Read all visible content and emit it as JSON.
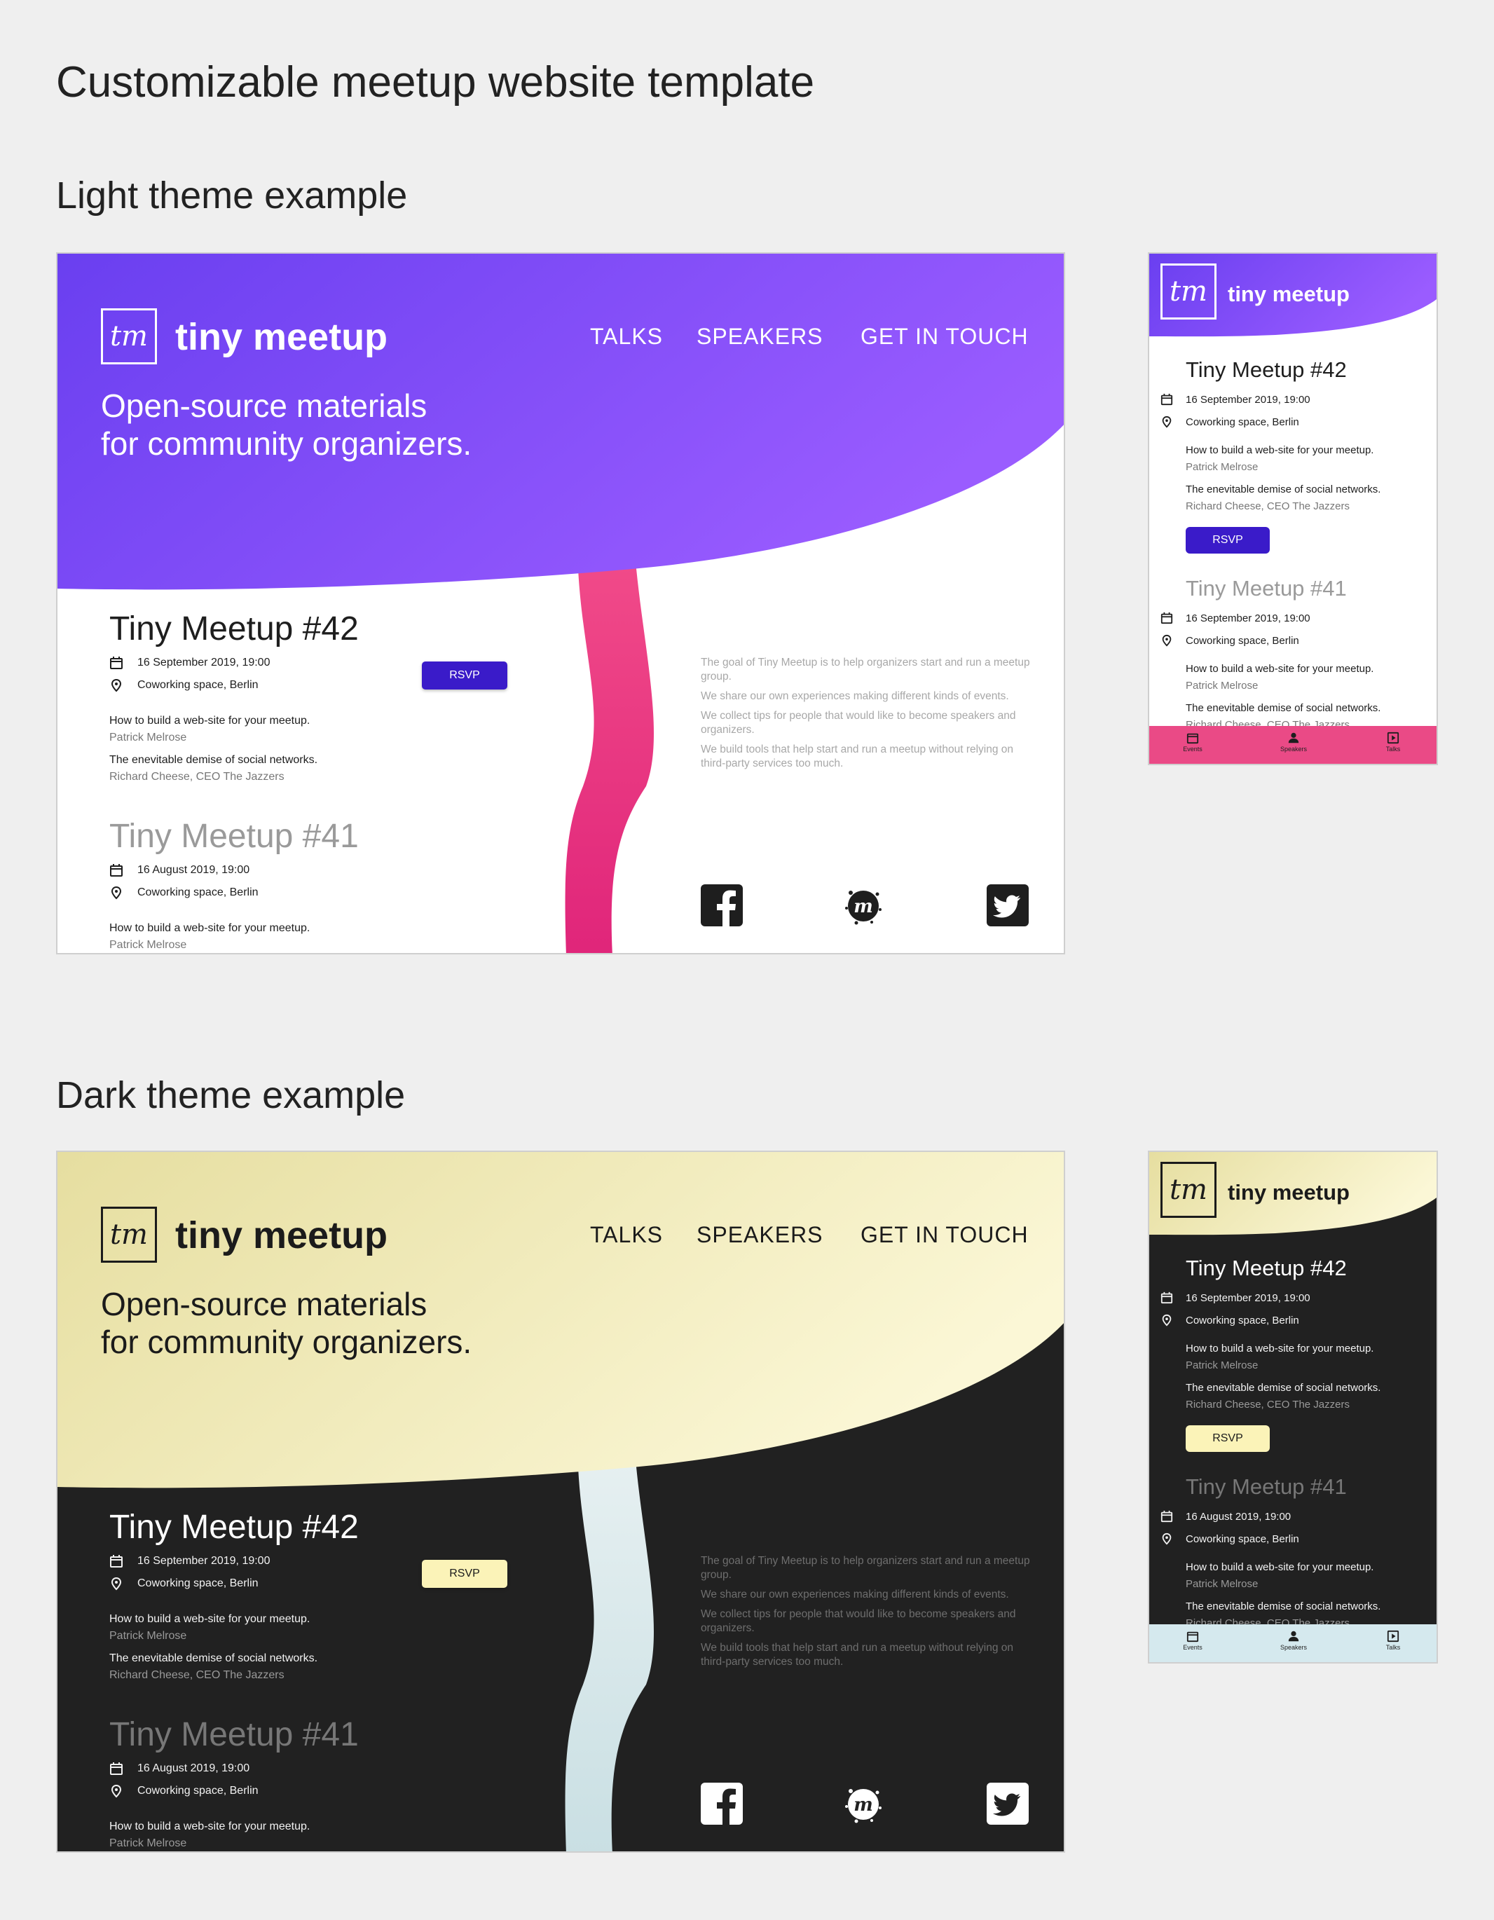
{
  "page": {
    "title": "Customizable meetup website template",
    "light_section": "Light theme example",
    "dark_section": "Dark theme example"
  },
  "site": {
    "logo_mark": "tm",
    "logo_text": "tiny meetup",
    "nav": [
      "TALKS",
      "SPEAKERS",
      "GET IN TOUCH"
    ],
    "tagline_line1": "Open-source materials",
    "tagline_line2": "for community organizers.",
    "rsvp_label": "RSVP",
    "about": [
      "The goal of Tiny Meetup is to help organizers start and run a meetup group.",
      "We share our own experiences making different kinds of events.",
      "We collect tips for people that would like to become speakers and organizers.",
      "We build tools that help start and run a meetup without relying on third-party services too much."
    ],
    "social_icons": [
      "facebook-icon",
      "meetup-icon",
      "twitter-icon"
    ],
    "tabs": [
      "Events",
      "Speakers",
      "Talks"
    ]
  },
  "events": [
    {
      "title": "Tiny Meetup #42",
      "date": "16 September 2019, 19:00",
      "location": "Coworking space, Berlin",
      "talks": [
        {
          "title": "How to build a web-site for your meetup.",
          "speaker": "Patrick Melrose"
        },
        {
          "title": "The enevitable demise of social networks.",
          "speaker": "Richard Cheese, CEO The Jazzers"
        }
      ]
    },
    {
      "title": "Tiny Meetup #41",
      "date": "16 August 2019, 19:00",
      "location": "Coworking space, Berlin",
      "talks": [
        {
          "title": "How to build a web-site for your meetup.",
          "speaker": "Patrick Melrose"
        },
        {
          "title": "The enevitable demise of social networks.",
          "speaker": "Richard Cheese, CEO The Jazzers"
        }
      ]
    }
  ],
  "themes": {
    "light": {
      "header_from": "#6a3ff0",
      "header_to": "#9a5cff",
      "ribbon": "#ea2f7a",
      "rsvp_bg": "#3a1bc9",
      "tabbar": "#ea4a86"
    },
    "dark": {
      "header_from": "#e9e2a6",
      "header_to": "#fbf6cf",
      "ribbon": "#d9e8ea",
      "rsvp_bg": "#fbf3b8",
      "tabbar": "#d5e9ee"
    }
  }
}
